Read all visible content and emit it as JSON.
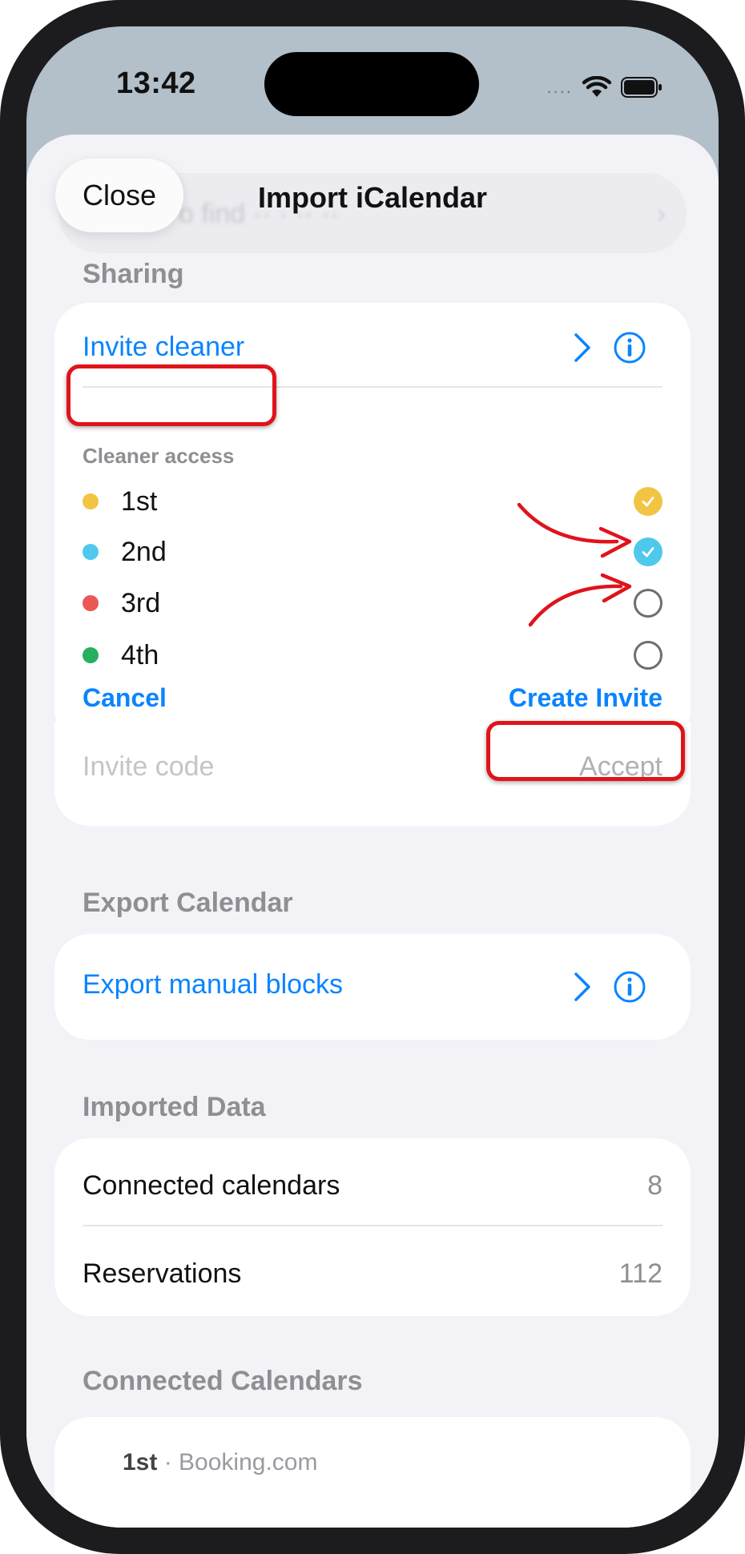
{
  "status_bar": {
    "time": "13:42",
    "signal": "....",
    "icons": [
      "wifi-icon",
      "battery-icon"
    ]
  },
  "nav": {
    "close_label": "Close",
    "title": "Import iCalendar"
  },
  "sharing": {
    "header": "Sharing",
    "invite_cleaner_label": "Invite cleaner",
    "access_label": "Cleaner access",
    "levels": [
      {
        "name": "1st",
        "color": "#f2c443",
        "checked": true
      },
      {
        "name": "2nd",
        "color": "#4fc8ee",
        "checked": true
      },
      {
        "name": "3rd",
        "color": "#ea5755",
        "checked": false
      },
      {
        "name": "4th",
        "color": "#27ae60",
        "checked": false
      }
    ],
    "cancel_label": "Cancel",
    "create_invite_label": "Create Invite",
    "invite_code_placeholder": "Invite code",
    "accept_label": "Accept"
  },
  "export": {
    "header": "Export Calendar",
    "export_blocks_label": "Export manual blocks"
  },
  "imported": {
    "header": "Imported Data",
    "rows": [
      {
        "label": "Connected calendars",
        "value": "8"
      },
      {
        "label": "Reservations",
        "value": "112"
      }
    ]
  },
  "connected": {
    "header": "Connected Calendars",
    "first_name": "1st",
    "first_source": "Booking.com"
  },
  "colors": {
    "accent": "#0a84ff",
    "annotation": "#e0131b"
  }
}
